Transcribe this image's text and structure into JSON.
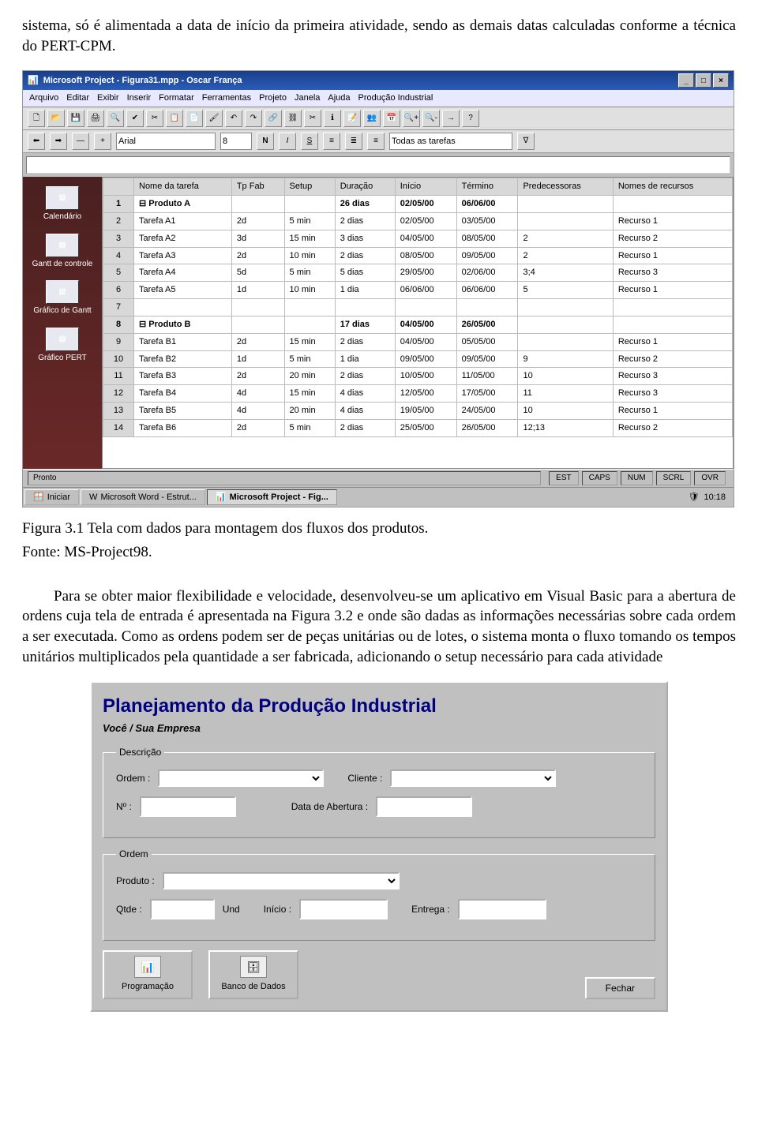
{
  "intro": "sistema, só é alimentada a data de início da primeira atividade, sendo as demais datas calculadas conforme a técnica do PERT-CPM.",
  "msp": {
    "title": "Microsoft Project - Figura31.mpp - Oscar França",
    "menus": [
      "Arquivo",
      "Editar",
      "Exibir",
      "Inserir",
      "Formatar",
      "Ferramentas",
      "Projeto",
      "Janela",
      "Ajuda",
      "Produção Industrial"
    ],
    "font_name": "Arial",
    "font_size": "8",
    "filter": "Todas as tarefas",
    "views": [
      "Calendário",
      "Gantt de controle",
      "Gráfico de Gantt",
      "Gráfico PERT"
    ],
    "cols": [
      "",
      "Nome da tarefa",
      "Tp Fab",
      "Setup",
      "Duração",
      "Início",
      "Término",
      "Predecessoras",
      "Nomes de recursos"
    ],
    "rows": [
      {
        "n": "1",
        "name": "⊟ Produto A",
        "tp": "",
        "setup": "",
        "dur": "26 dias",
        "ini": "02/05/00",
        "ter": "06/06/00",
        "pred": "",
        "res": "",
        "bold": true
      },
      {
        "n": "2",
        "name": "    Tarefa A1",
        "tp": "2d",
        "setup": "5 min",
        "dur": "2 dias",
        "ini": "02/05/00",
        "ter": "03/05/00",
        "pred": "",
        "res": "Recurso 1"
      },
      {
        "n": "3",
        "name": "    Tarefa A2",
        "tp": "3d",
        "setup": "15 min",
        "dur": "3 dias",
        "ini": "04/05/00",
        "ter": "08/05/00",
        "pred": "2",
        "res": "Recurso 2"
      },
      {
        "n": "4",
        "name": "    Tarefa A3",
        "tp": "2d",
        "setup": "10 min",
        "dur": "2 dias",
        "ini": "08/05/00",
        "ter": "09/05/00",
        "pred": "2",
        "res": "Recurso 1"
      },
      {
        "n": "5",
        "name": "    Tarefa A4",
        "tp": "5d",
        "setup": "5 min",
        "dur": "5 dias",
        "ini": "29/05/00",
        "ter": "02/06/00",
        "pred": "3;4",
        "res": "Recurso 3"
      },
      {
        "n": "6",
        "name": "    Tarefa A5",
        "tp": "1d",
        "setup": "10 min",
        "dur": "1 dia",
        "ini": "06/06/00",
        "ter": "06/06/00",
        "pred": "5",
        "res": "Recurso 1"
      },
      {
        "n": "7",
        "name": "",
        "tp": "",
        "setup": "",
        "dur": "",
        "ini": "",
        "ter": "",
        "pred": "",
        "res": ""
      },
      {
        "n": "8",
        "name": "⊟ Produto B",
        "tp": "",
        "setup": "",
        "dur": "17 dias",
        "ini": "04/05/00",
        "ter": "26/05/00",
        "pred": "",
        "res": "",
        "bold": true
      },
      {
        "n": "9",
        "name": "    Tarefa B1",
        "tp": "2d",
        "setup": "15 min",
        "dur": "2 dias",
        "ini": "04/05/00",
        "ter": "05/05/00",
        "pred": "",
        "res": "Recurso 1"
      },
      {
        "n": "10",
        "name": "    Tarefa B2",
        "tp": "1d",
        "setup": "5 min",
        "dur": "1 dia",
        "ini": "09/05/00",
        "ter": "09/05/00",
        "pred": "9",
        "res": "Recurso 2"
      },
      {
        "n": "11",
        "name": "    Tarefa B3",
        "tp": "2d",
        "setup": "20 min",
        "dur": "2 dias",
        "ini": "10/05/00",
        "ter": "11/05/00",
        "pred": "10",
        "res": "Recurso 3"
      },
      {
        "n": "12",
        "name": "    Tarefa B4",
        "tp": "4d",
        "setup": "15 min",
        "dur": "4 dias",
        "ini": "12/05/00",
        "ter": "17/05/00",
        "pred": "11",
        "res": "Recurso 3"
      },
      {
        "n": "13",
        "name": "    Tarefa B5",
        "tp": "4d",
        "setup": "20 min",
        "dur": "4 dias",
        "ini": "19/05/00",
        "ter": "24/05/00",
        "pred": "10",
        "res": "Recurso 1"
      },
      {
        "n": "14",
        "name": "    Tarefa B6",
        "tp": "2d",
        "setup": "5 min",
        "dur": "2 dias",
        "ini": "25/05/00",
        "ter": "26/05/00",
        "pred": "12;13",
        "res": "Recurso 2"
      }
    ],
    "status": {
      "ready": "Pronto",
      "indicators": [
        "EST",
        "CAPS",
        "NUM",
        "SCRL",
        "OVR"
      ]
    },
    "taskbar": {
      "start": "Iniciar",
      "word": "Microsoft Word - Estrut...",
      "project": "Microsoft Project - Fig...",
      "clock": "10:18"
    }
  },
  "fig31_caption": "Figura 3.1 Tela com dados para montagem dos fluxos dos produtos.",
  "fig31_source": "Fonte: MS-Project98.",
  "para2": "Para se obter maior flexibilidade e velocidade, desenvolveu-se um aplicativo em Visual Basic para a abertura de ordens cuja tela de entrada é apresentada na Figura 3.2 e onde são dadas as informações necessárias sobre cada ordem a ser executada. Como as ordens podem ser de peças unitárias ou de lotes, o sistema monta o fluxo tomando os tempos unitários multiplicados pela quantidade a ser fabricada, adicionando o setup necessário para cada atividade",
  "vb": {
    "title": "Planejamento da Produção Industrial",
    "subtitle": "Você / Sua Empresa",
    "desc_legend": "Descrição",
    "ordem_label": "Ordem :",
    "cliente_label": "Cliente :",
    "num_label": "Nº :",
    "data_label": "Data de Abertura :",
    "ordem_legend": "Ordem",
    "produto_label": "Produto :",
    "qtde_label": "Qtde :",
    "und_label": "Und",
    "inicio_label": "Início :",
    "entrega_label": "Entrega :",
    "prog_btn": "Programação",
    "banco_btn": "Banco de Dados",
    "fechar_btn": "Fechar"
  }
}
